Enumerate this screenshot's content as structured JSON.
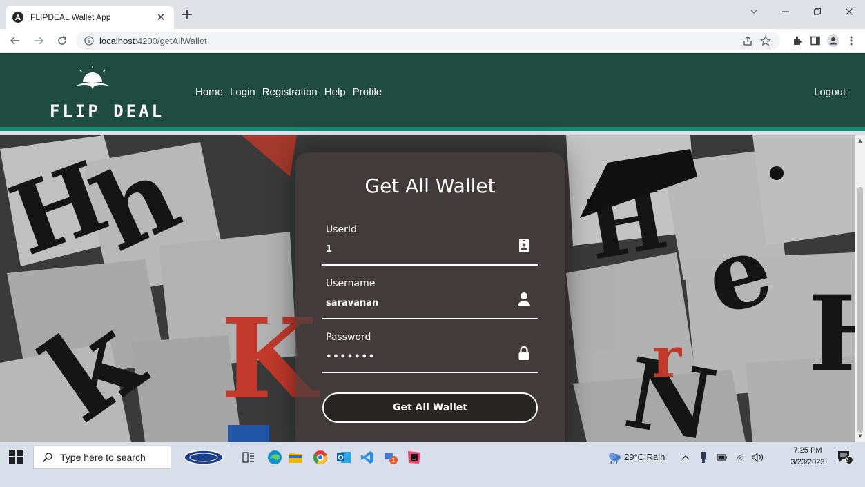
{
  "browser": {
    "tab_title": "FLIPDEAL Wallet App",
    "url_host": "localhost",
    "url_path": ":4200/getAllWallet"
  },
  "navbar": {
    "logo_text": "FLIP DEAL",
    "links": [
      "Home",
      "Login",
      "Registration",
      "Help",
      "Profile"
    ],
    "logout": "Logout"
  },
  "form": {
    "title": "Get All Wallet",
    "userid_label": "UserId",
    "userid_value": "1",
    "username_label": "Username",
    "username_value": "saravanan",
    "password_label": "Password",
    "password_value": "•••••••",
    "submit_label": "Get All Wallet"
  },
  "taskbar": {
    "search_placeholder": "Type here to search",
    "weather": "29°C Rain",
    "time": "7:25 PM",
    "date": "3/23/2023",
    "notification_count": "3"
  },
  "colors": {
    "navbar_bg": "#204b40",
    "navbar_accent": "#0e8a73",
    "card_bg": "rgba(70,60,60,0.72)"
  },
  "icons": {
    "userid": "id-badge-icon",
    "username": "user-icon",
    "password": "lock-icon"
  }
}
